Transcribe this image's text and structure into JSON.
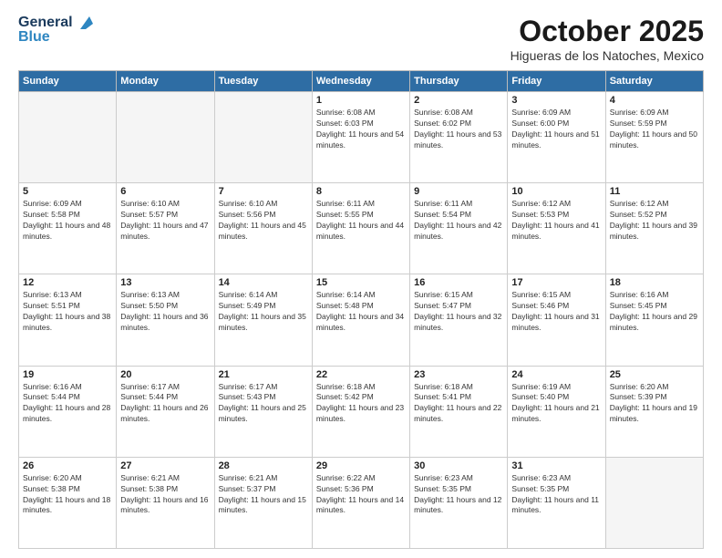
{
  "header": {
    "logo_line1": "General",
    "logo_line2": "Blue",
    "month_title": "October 2025",
    "subtitle": "Higueras de los Natoches, Mexico"
  },
  "weekdays": [
    "Sunday",
    "Monday",
    "Tuesday",
    "Wednesday",
    "Thursday",
    "Friday",
    "Saturday"
  ],
  "weeks": [
    [
      {
        "day": "",
        "sunrise": "",
        "sunset": "",
        "daylight": "",
        "empty": true
      },
      {
        "day": "",
        "sunrise": "",
        "sunset": "",
        "daylight": "",
        "empty": true
      },
      {
        "day": "",
        "sunrise": "",
        "sunset": "",
        "daylight": "",
        "empty": true
      },
      {
        "day": "1",
        "sunrise": "Sunrise: 6:08 AM",
        "sunset": "Sunset: 6:03 PM",
        "daylight": "Daylight: 11 hours and 54 minutes."
      },
      {
        "day": "2",
        "sunrise": "Sunrise: 6:08 AM",
        "sunset": "Sunset: 6:02 PM",
        "daylight": "Daylight: 11 hours and 53 minutes."
      },
      {
        "day": "3",
        "sunrise": "Sunrise: 6:09 AM",
        "sunset": "Sunset: 6:00 PM",
        "daylight": "Daylight: 11 hours and 51 minutes."
      },
      {
        "day": "4",
        "sunrise": "Sunrise: 6:09 AM",
        "sunset": "Sunset: 5:59 PM",
        "daylight": "Daylight: 11 hours and 50 minutes."
      }
    ],
    [
      {
        "day": "5",
        "sunrise": "Sunrise: 6:09 AM",
        "sunset": "Sunset: 5:58 PM",
        "daylight": "Daylight: 11 hours and 48 minutes."
      },
      {
        "day": "6",
        "sunrise": "Sunrise: 6:10 AM",
        "sunset": "Sunset: 5:57 PM",
        "daylight": "Daylight: 11 hours and 47 minutes."
      },
      {
        "day": "7",
        "sunrise": "Sunrise: 6:10 AM",
        "sunset": "Sunset: 5:56 PM",
        "daylight": "Daylight: 11 hours and 45 minutes."
      },
      {
        "day": "8",
        "sunrise": "Sunrise: 6:11 AM",
        "sunset": "Sunset: 5:55 PM",
        "daylight": "Daylight: 11 hours and 44 minutes."
      },
      {
        "day": "9",
        "sunrise": "Sunrise: 6:11 AM",
        "sunset": "Sunset: 5:54 PM",
        "daylight": "Daylight: 11 hours and 42 minutes."
      },
      {
        "day": "10",
        "sunrise": "Sunrise: 6:12 AM",
        "sunset": "Sunset: 5:53 PM",
        "daylight": "Daylight: 11 hours and 41 minutes."
      },
      {
        "day": "11",
        "sunrise": "Sunrise: 6:12 AM",
        "sunset": "Sunset: 5:52 PM",
        "daylight": "Daylight: 11 hours and 39 minutes."
      }
    ],
    [
      {
        "day": "12",
        "sunrise": "Sunrise: 6:13 AM",
        "sunset": "Sunset: 5:51 PM",
        "daylight": "Daylight: 11 hours and 38 minutes."
      },
      {
        "day": "13",
        "sunrise": "Sunrise: 6:13 AM",
        "sunset": "Sunset: 5:50 PM",
        "daylight": "Daylight: 11 hours and 36 minutes."
      },
      {
        "day": "14",
        "sunrise": "Sunrise: 6:14 AM",
        "sunset": "Sunset: 5:49 PM",
        "daylight": "Daylight: 11 hours and 35 minutes."
      },
      {
        "day": "15",
        "sunrise": "Sunrise: 6:14 AM",
        "sunset": "Sunset: 5:48 PM",
        "daylight": "Daylight: 11 hours and 34 minutes."
      },
      {
        "day": "16",
        "sunrise": "Sunrise: 6:15 AM",
        "sunset": "Sunset: 5:47 PM",
        "daylight": "Daylight: 11 hours and 32 minutes."
      },
      {
        "day": "17",
        "sunrise": "Sunrise: 6:15 AM",
        "sunset": "Sunset: 5:46 PM",
        "daylight": "Daylight: 11 hours and 31 minutes."
      },
      {
        "day": "18",
        "sunrise": "Sunrise: 6:16 AM",
        "sunset": "Sunset: 5:45 PM",
        "daylight": "Daylight: 11 hours and 29 minutes."
      }
    ],
    [
      {
        "day": "19",
        "sunrise": "Sunrise: 6:16 AM",
        "sunset": "Sunset: 5:44 PM",
        "daylight": "Daylight: 11 hours and 28 minutes."
      },
      {
        "day": "20",
        "sunrise": "Sunrise: 6:17 AM",
        "sunset": "Sunset: 5:44 PM",
        "daylight": "Daylight: 11 hours and 26 minutes."
      },
      {
        "day": "21",
        "sunrise": "Sunrise: 6:17 AM",
        "sunset": "Sunset: 5:43 PM",
        "daylight": "Daylight: 11 hours and 25 minutes."
      },
      {
        "day": "22",
        "sunrise": "Sunrise: 6:18 AM",
        "sunset": "Sunset: 5:42 PM",
        "daylight": "Daylight: 11 hours and 23 minutes."
      },
      {
        "day": "23",
        "sunrise": "Sunrise: 6:18 AM",
        "sunset": "Sunset: 5:41 PM",
        "daylight": "Daylight: 11 hours and 22 minutes."
      },
      {
        "day": "24",
        "sunrise": "Sunrise: 6:19 AM",
        "sunset": "Sunset: 5:40 PM",
        "daylight": "Daylight: 11 hours and 21 minutes."
      },
      {
        "day": "25",
        "sunrise": "Sunrise: 6:20 AM",
        "sunset": "Sunset: 5:39 PM",
        "daylight": "Daylight: 11 hours and 19 minutes."
      }
    ],
    [
      {
        "day": "26",
        "sunrise": "Sunrise: 6:20 AM",
        "sunset": "Sunset: 5:38 PM",
        "daylight": "Daylight: 11 hours and 18 minutes."
      },
      {
        "day": "27",
        "sunrise": "Sunrise: 6:21 AM",
        "sunset": "Sunset: 5:38 PM",
        "daylight": "Daylight: 11 hours and 16 minutes."
      },
      {
        "day": "28",
        "sunrise": "Sunrise: 6:21 AM",
        "sunset": "Sunset: 5:37 PM",
        "daylight": "Daylight: 11 hours and 15 minutes."
      },
      {
        "day": "29",
        "sunrise": "Sunrise: 6:22 AM",
        "sunset": "Sunset: 5:36 PM",
        "daylight": "Daylight: 11 hours and 14 minutes."
      },
      {
        "day": "30",
        "sunrise": "Sunrise: 6:23 AM",
        "sunset": "Sunset: 5:35 PM",
        "daylight": "Daylight: 11 hours and 12 minutes."
      },
      {
        "day": "31",
        "sunrise": "Sunrise: 6:23 AM",
        "sunset": "Sunset: 5:35 PM",
        "daylight": "Daylight: 11 hours and 11 minutes."
      },
      {
        "day": "",
        "sunrise": "",
        "sunset": "",
        "daylight": "",
        "empty": true
      }
    ]
  ]
}
